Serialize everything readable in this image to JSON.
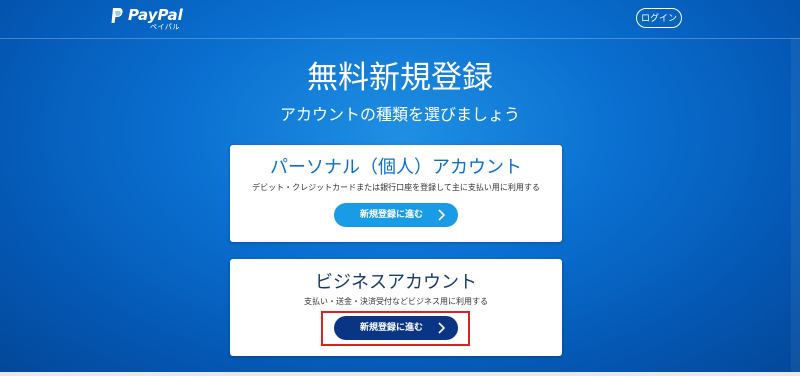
{
  "header": {
    "logo_text": "PayPal",
    "logo_subtext": "ペイパル",
    "login_label": "ログイン"
  },
  "hero": {
    "title": "無料新規登録",
    "subtitle": "アカウントの種類を選びましょう"
  },
  "cards": {
    "personal": {
      "title": "パーソナル（個人）アカウント",
      "description": "デビット・クレジットカードまたは銀行口座を登録して主に支払い用に利用する",
      "button_label": "新規登録に進む",
      "button_color": "#1a9be6"
    },
    "business": {
      "title": "ビジネスアカウント",
      "description": "支払い・送金・決済受付などビジネス用に利用する",
      "button_label": "新規登録に進む",
      "button_color": "#0a3585"
    }
  },
  "icons": {
    "logo": "paypal-logo-icon",
    "chevron": "chevron-right-icon"
  },
  "highlight_color": "#e02020"
}
